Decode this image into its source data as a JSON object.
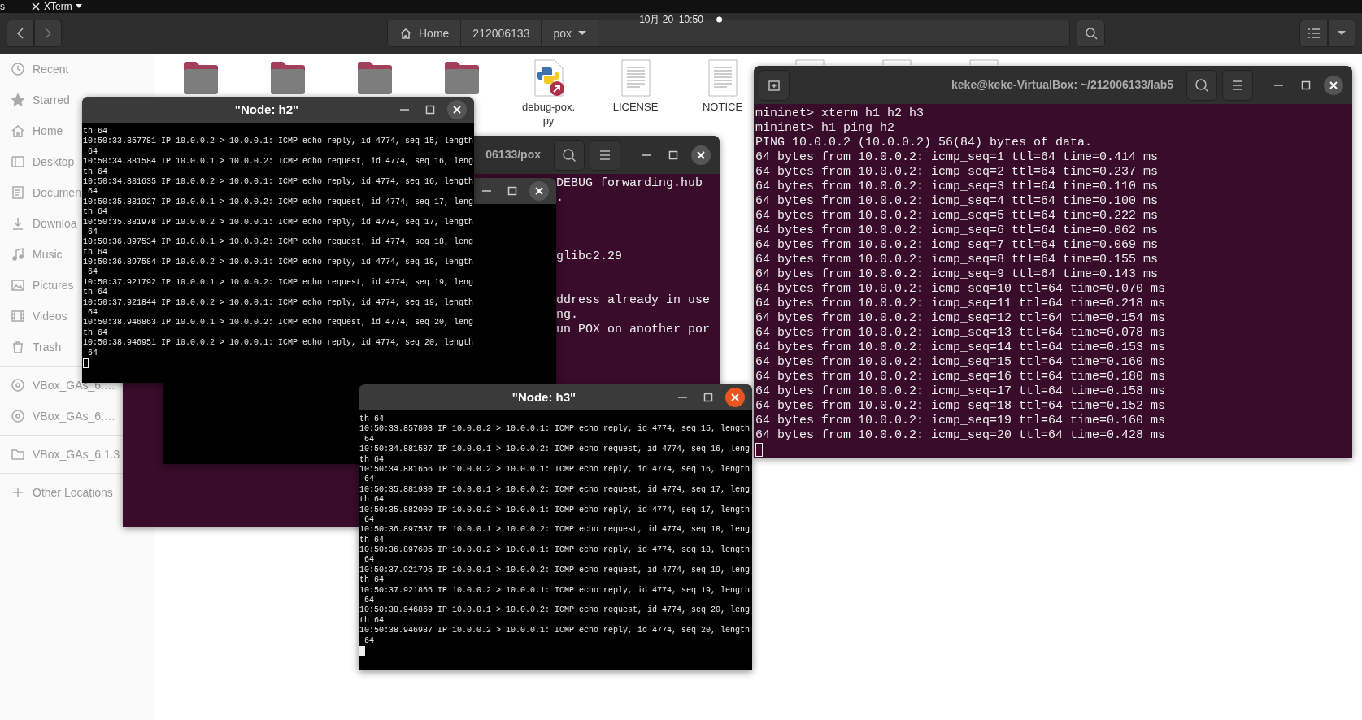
{
  "top_bar": {
    "left_fragment": "s",
    "app_menu": "XTerm",
    "clock": "10月 20  10:50"
  },
  "file_manager": {
    "path": [
      {
        "label": "Home",
        "kind": "home"
      },
      {
        "label": "212006133",
        "kind": "plain"
      },
      {
        "label": "pox",
        "kind": "menu"
      }
    ],
    "sidebar": [
      {
        "items": [
          {
            "label": "Recent",
            "kind": "recent"
          },
          {
            "label": "Starred",
            "kind": "starred"
          },
          {
            "label": "Home",
            "kind": "home"
          },
          {
            "label": "Desktop",
            "kind": "desktop"
          },
          {
            "label": "Documen",
            "kind": "documents"
          },
          {
            "label": "Downloa",
            "kind": "downloads"
          },
          {
            "label": "Music",
            "kind": "music"
          },
          {
            "label": "Pictures",
            "kind": "pictures"
          },
          {
            "label": "Videos",
            "kind": "videos"
          },
          {
            "label": "Trash",
            "kind": "trash"
          }
        ]
      },
      {
        "items": [
          {
            "label": "VBox_GAs_6.…",
            "kind": "disc"
          },
          {
            "label": "VBox_GAs_6.…",
            "kind": "disc"
          }
        ]
      },
      {
        "items": [
          {
            "label": "VBox_GAs_6.1.3",
            "kind": "folder"
          }
        ]
      },
      {
        "items": [
          {
            "label": "Other Locations",
            "kind": "other"
          }
        ]
      }
    ],
    "files": [
      {
        "kind": "folder"
      },
      {
        "kind": "folder"
      },
      {
        "kind": "folder"
      },
      {
        "kind": "folder"
      },
      {
        "kind": "python",
        "name": "debug-pox.py"
      },
      {
        "kind": "text",
        "name": "LICENSE"
      },
      {
        "kind": "text",
        "name": "NOTICE"
      },
      {
        "kind": "file"
      },
      {
        "kind": "file"
      },
      {
        "kind": "file"
      }
    ]
  },
  "windows": [
    {
      "kind": "terminal",
      "title": "06133/pox",
      "blocks": [
        [
          "DEBUG forwarding.hub",
          "."
        ],
        [
          "glibc2.29"
        ],
        [
          "ddress already in use",
          "ng.",
          "un POX on another por"
        ]
      ]
    },
    {
      "kind": "xterm",
      "focused": false
    },
    {
      "kind": "xterm",
      "title": "\"Node: h2\"",
      "focused": false,
      "lines": [
        "th 64",
        "10:50:33.857781 IP 10.0.0.2 > 10.0.0.1: ICMP echo reply, id 4774, seq 15, length",
        " 64",
        "10:50:34.881584 IP 10.0.0.1 > 10.0.0.2: ICMP echo request, id 4774, seq 16, leng",
        "th 64",
        "10:50:34.881635 IP 10.0.0.2 > 10.0.0.1: ICMP echo reply, id 4774, seq 16, length",
        " 64",
        "10:50:35.881927 IP 10.0.0.1 > 10.0.0.2: ICMP echo request, id 4774, seq 17, leng",
        "th 64",
        "10:50:35.881978 IP 10.0.0.2 > 10.0.0.1: ICMP echo reply, id 4774, seq 17, length",
        " 64",
        "10:50:36.897534 IP 10.0.0.1 > 10.0.0.2: ICMP echo request, id 4774, seq 18, leng",
        "th 64",
        "10:50:36.897584 IP 10.0.0.2 > 10.0.0.1: ICMP echo reply, id 4774, seq 18, length",
        " 64",
        "10:50:37.921792 IP 10.0.0.1 > 10.0.0.2: ICMP echo request, id 4774, seq 19, leng",
        "th 64",
        "10:50:37.921844 IP 10.0.0.2 > 10.0.0.1: ICMP echo reply, id 4774, seq 19, length",
        " 64",
        "10:50:38.946863 IP 10.0.0.1 > 10.0.0.2: ICMP echo request, id 4774, seq 20, leng",
        "th 64",
        "10:50:38.946951 IP 10.0.0.2 > 10.0.0.1: ICMP echo reply, id 4774, seq 20, length",
        " 64"
      ]
    },
    {
      "kind": "xterm",
      "title": "\"Node: h3\"",
      "focused": true,
      "lines": [
        "th 64",
        "10:50:33.857803 IP 10.0.0.2 > 10.0.0.1: ICMP echo reply, id 4774, seq 15, length",
        " 64",
        "10:50:34.881587 IP 10.0.0.1 > 10.0.0.2: ICMP echo request, id 4774, seq 16, leng",
        "th 64",
        "10:50:34.881656 IP 10.0.0.2 > 10.0.0.1: ICMP echo reply, id 4774, seq 16, length",
        " 64",
        "10:50:35.881930 IP 10.0.0.1 > 10.0.0.2: ICMP echo request, id 4774, seq 17, leng",
        "th 64",
        "10:50:35.882000 IP 10.0.0.2 > 10.0.0.1: ICMP echo reply, id 4774, seq 17, length",
        " 64",
        "10:50:36.897537 IP 10.0.0.1 > 10.0.0.2: ICMP echo request, id 4774, seq 18, leng",
        "th 64",
        "10:50:36.897605 IP 10.0.0.2 > 10.0.0.1: ICMP echo reply, id 4774, seq 18, length",
        " 64",
        "10:50:37.921795 IP 10.0.0.1 > 10.0.0.2: ICMP echo request, id 4774, seq 19, leng",
        "th 64",
        "10:50:37.921866 IP 10.0.0.2 > 10.0.0.1: ICMP echo reply, id 4774, seq 19, length",
        " 64",
        "10:50:38.946869 IP 10.0.0.1 > 10.0.0.2: ICMP echo request, id 4774, seq 20, leng",
        "th 64",
        "10:50:38.946987 IP 10.0.0.2 > 10.0.0.1: ICMP echo reply, id 4774, seq 20, length",
        " 64"
      ]
    },
    {
      "kind": "terminal",
      "title": "keke@keke-VirtualBox: ~/212006133/lab5",
      "new_tab_button": true,
      "lines": [
        "mininet> xterm h1 h2 h3",
        "mininet> h1 ping h2",
        "PING 10.0.0.2 (10.0.0.2) 56(84) bytes of data.",
        "64 bytes from 10.0.0.2: icmp_seq=1 ttl=64 time=0.414 ms",
        "64 bytes from 10.0.0.2: icmp_seq=2 ttl=64 time=0.237 ms",
        "64 bytes from 10.0.0.2: icmp_seq=3 ttl=64 time=0.110 ms",
        "64 bytes from 10.0.0.2: icmp_seq=4 ttl=64 time=0.100 ms",
        "64 bytes from 10.0.0.2: icmp_seq=5 ttl=64 time=0.222 ms",
        "64 bytes from 10.0.0.2: icmp_seq=6 ttl=64 time=0.062 ms",
        "64 bytes from 10.0.0.2: icmp_seq=7 ttl=64 time=0.069 ms",
        "64 bytes from 10.0.0.2: icmp_seq=8 ttl=64 time=0.155 ms",
        "64 bytes from 10.0.0.2: icmp_seq=9 ttl=64 time=0.143 ms",
        "64 bytes from 10.0.0.2: icmp_seq=10 ttl=64 time=0.070 ms",
        "64 bytes from 10.0.0.2: icmp_seq=11 ttl=64 time=0.218 ms",
        "64 bytes from 10.0.0.2: icmp_seq=12 ttl=64 time=0.154 ms",
        "64 bytes from 10.0.0.2: icmp_seq=13 ttl=64 time=0.078 ms",
        "64 bytes from 10.0.0.2: icmp_seq=14 ttl=64 time=0.153 ms",
        "64 bytes from 10.0.0.2: icmp_seq=15 ttl=64 time=0.160 ms",
        "64 bytes from 10.0.0.2: icmp_seq=16 ttl=64 time=0.180 ms",
        "64 bytes from 10.0.0.2: icmp_seq=17 ttl=64 time=0.158 ms",
        "64 bytes from 10.0.0.2: icmp_seq=18 ttl=64 time=0.152 ms",
        "64 bytes from 10.0.0.2: icmp_seq=19 ttl=64 time=0.160 ms",
        "64 bytes from 10.0.0.2: icmp_seq=20 ttl=64 time=0.428 ms"
      ]
    }
  ]
}
